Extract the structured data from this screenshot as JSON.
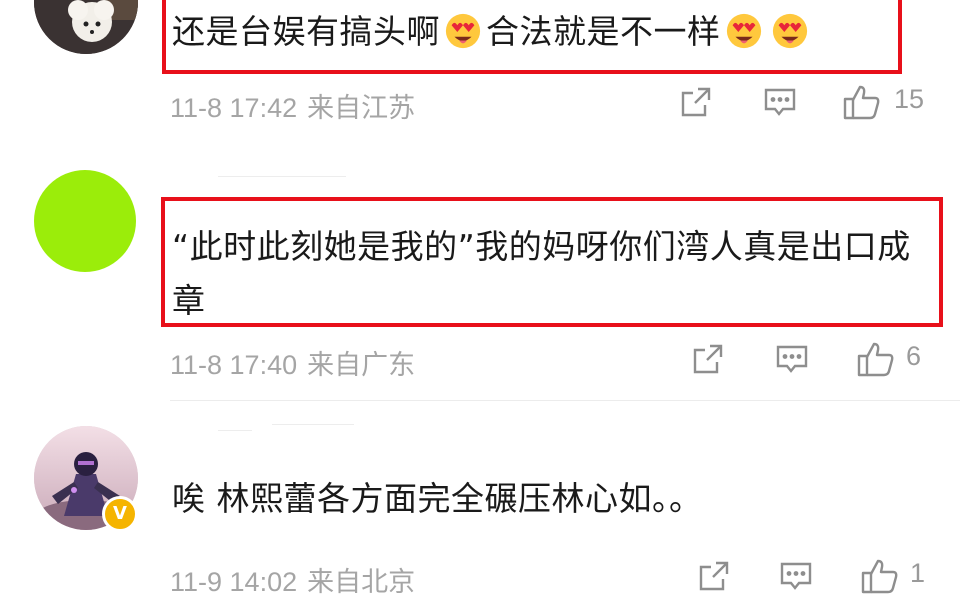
{
  "comments": [
    {
      "text_before_emoji": "还是台娱有搞头啊",
      "text_middle": "合法就是不一样",
      "time": "11-8 17:42",
      "location": "来自江苏",
      "likes": "15",
      "avatar": "photo-avatar-dog"
    },
    {
      "text": "“此时此刻她是我的”我的妈呀你们湾人真是出口成章",
      "time": "11-8 17:40",
      "location": "来自广东",
      "likes": "6",
      "avatar_color": "#9bed0a"
    },
    {
      "text": "唉 林熙蕾各方面完全碾压林心如。。",
      "time": "11-9 14:02",
      "location": "来自北京",
      "likes": "1",
      "avatar": "photo-avatar-figure",
      "verified_badge": "V"
    }
  ],
  "colors": {
    "highlight": "#e8101a",
    "meta_text": "#a5a5a5",
    "verified_badge": "#f5b400"
  },
  "icons": [
    "share-icon",
    "comment-icon",
    "like-icon",
    "heart-eyes-emoji"
  ]
}
